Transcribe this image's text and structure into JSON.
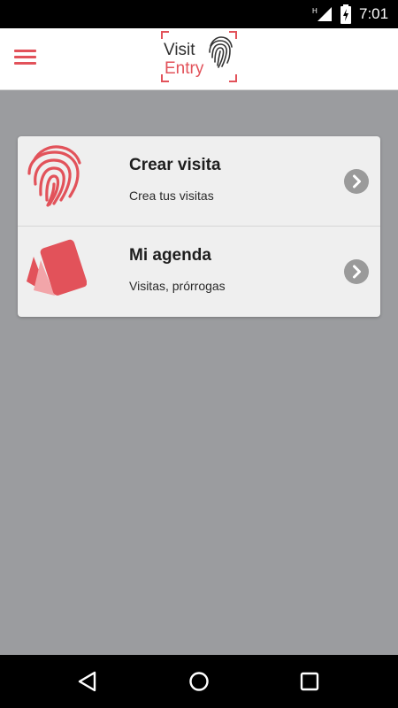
{
  "status_bar": {
    "time": "7:01",
    "icons": [
      "no-sim-signal-icon",
      "battery-charging-icon"
    ]
  },
  "app_bar": {
    "menu_icon": "hamburger-menu-icon",
    "logo": {
      "word_top": "Visit",
      "word_bottom": "Entry",
      "emblem": "fingerprint-icon"
    }
  },
  "menu": {
    "items": [
      {
        "title": "Crear visita",
        "subtitle": "Crea tus visitas",
        "icon": "fingerprint-icon"
      },
      {
        "title": "Mi agenda",
        "subtitle": "Visitas, prórrogas",
        "icon": "agenda-cards-icon"
      }
    ],
    "chevron_icon": "chevron-right-circle-icon"
  },
  "nav_bar": {
    "buttons": [
      "back-triangle-icon",
      "home-circle-icon",
      "recents-square-icon"
    ]
  },
  "colors": {
    "accent": "#e2525a",
    "background": "#9b9c9f",
    "card": "#efefef",
    "app_bar": "#ffffff"
  }
}
